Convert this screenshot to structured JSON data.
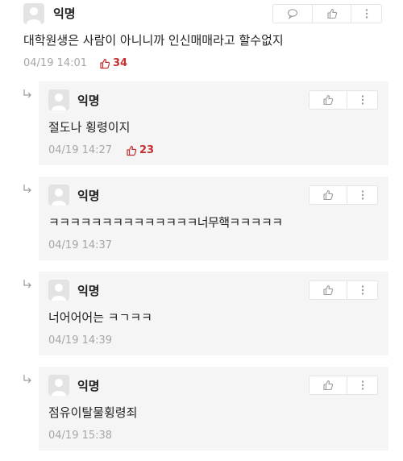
{
  "post": {
    "author": "익명",
    "text": "대학원생은 사람이 아니니까 인신매매라고 할수없지",
    "time": "04/19 14:01",
    "likes": "34"
  },
  "replies": [
    {
      "author": "익명",
      "text": "절도나 횡령이지",
      "time": "04/19 14:27",
      "likes": "23"
    },
    {
      "author": "익명",
      "text": "ㅋㅋㅋㅋㅋㅋㅋㅋㅋㅋㅋㅋㅋㅋ너무핵ㅋㅋㅋㅋㅋ",
      "time": "04/19 14:37"
    },
    {
      "author": "익명",
      "text": "너어어어는 ㅋㄱㅋㅋ",
      "time": "04/19 14:39"
    },
    {
      "author": "익명",
      "text": "점유이탈물횡령죄",
      "time": "04/19 15:38"
    }
  ],
  "icons": {
    "comment": "speech-bubble-icon",
    "like": "thumbs-up-icon",
    "more": "vertical-dots-icon",
    "reply_arrow": "reply-arrow-icon",
    "avatar": "default-user-avatar"
  },
  "colors": {
    "like_count": "#c2302f",
    "reply_background": "#f5f5f5",
    "timestamp": "#a6a6a6"
  }
}
